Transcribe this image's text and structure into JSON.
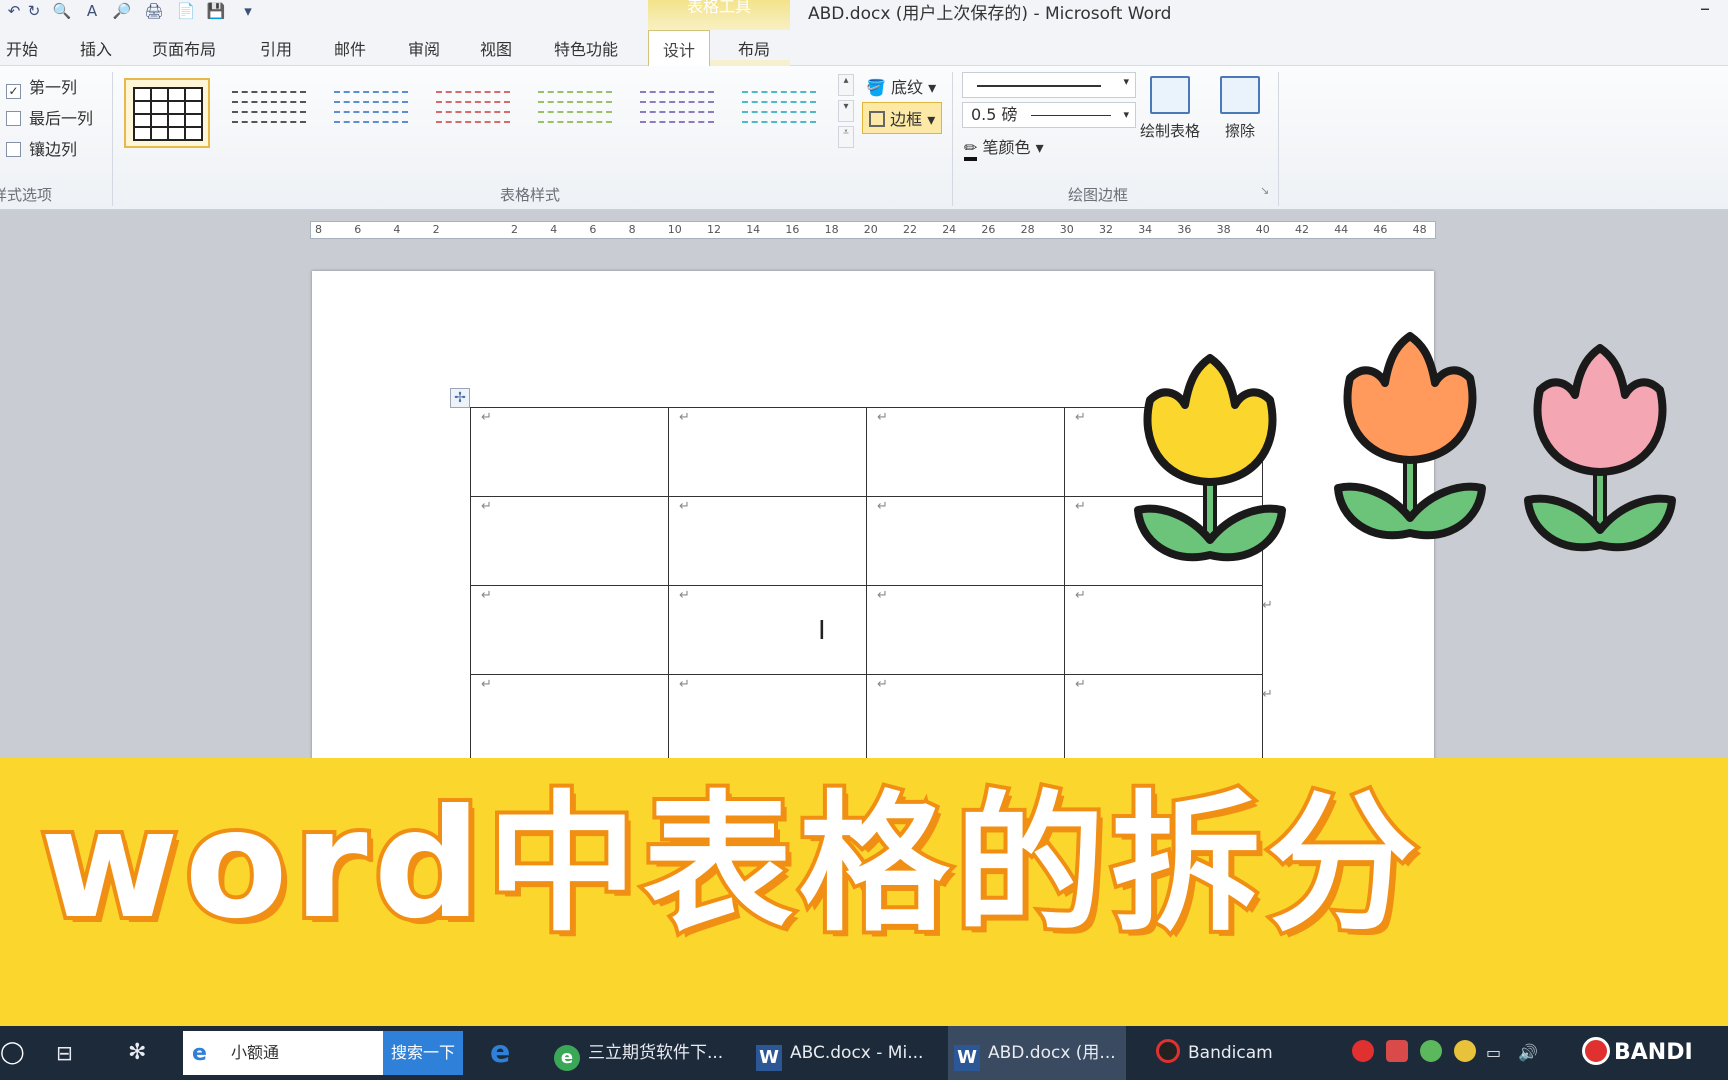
{
  "window": {
    "title": "ABD.docx (用户上次保存的)  -  Microsoft Word",
    "context_tools_label": "表格工具",
    "minimize": "–"
  },
  "quick_access": [
    "↶",
    "↻",
    "🔍",
    "A",
    "🔎",
    "🖨",
    "📄",
    "💾",
    "▾"
  ],
  "tabs": {
    "home": "开始",
    "insert": "插入",
    "page_layout": "页面布局",
    "references": "引用",
    "mailings": "邮件",
    "review": "审阅",
    "view": "视图",
    "special": "特色功能",
    "design": "设计",
    "layout": "布局"
  },
  "ribbon": {
    "style_options": {
      "first_column": "第一列",
      "last_column": "最后一列",
      "banded_columns": "镶边列",
      "group_label": "样式选项",
      "first_column_checked": true
    },
    "table_styles": {
      "group_label": "表格样式",
      "thumb_colors": [
        "#333333",
        "#555555",
        "#5b8fd1",
        "#d86a6a",
        "#9cc06a",
        "#8e7bbf",
        "#4fb8c9"
      ]
    },
    "shading": "底纹",
    "borders": "边框",
    "line_weight": "0.5 磅",
    "pen_color": "笔颜色",
    "draw_borders": {
      "group_label": "绘图边框",
      "draw_table": "绘制表格",
      "eraser": "擦除"
    }
  },
  "ruler": {
    "ticks": [
      "8",
      "6",
      "4",
      "2",
      "",
      "2",
      "4",
      "6",
      "8",
      "10",
      "12",
      "14",
      "16",
      "18",
      "20",
      "22",
      "24",
      "26",
      "28",
      "30",
      "32",
      "34",
      "36",
      "38",
      "40",
      "42",
      "44",
      "46",
      "48"
    ]
  },
  "document": {
    "rows": 4,
    "columns": 4,
    "cell_mark": "↵",
    "move_handle": "✢",
    "cursor": "I"
  },
  "banner": {
    "title": "word中表格的拆分",
    "bg_color": "#fbd72e",
    "stroke_color": "#f08f13"
  },
  "tulips": [
    {
      "petal": "#fbd72e",
      "leaf": "#6cc47a"
    },
    {
      "petal": "#ff9a5c",
      "leaf": "#6cc47a"
    },
    {
      "petal": "#f4a7b2",
      "leaf": "#6cc47a"
    }
  ],
  "taskbar": {
    "search_text": "小额通",
    "search_button": "搜索一下",
    "items": [
      {
        "label": "三立期货软件下...",
        "icon": "green-app-icon"
      },
      {
        "label": "ABC.docx - Mi...",
        "icon": "word-icon"
      },
      {
        "label": "ABD.docx (用...",
        "icon": "word-icon"
      },
      {
        "label": "Bandicam",
        "icon": "record-icon"
      }
    ],
    "bandicam_watermark": "BANDI",
    "word_letter": "W"
  }
}
